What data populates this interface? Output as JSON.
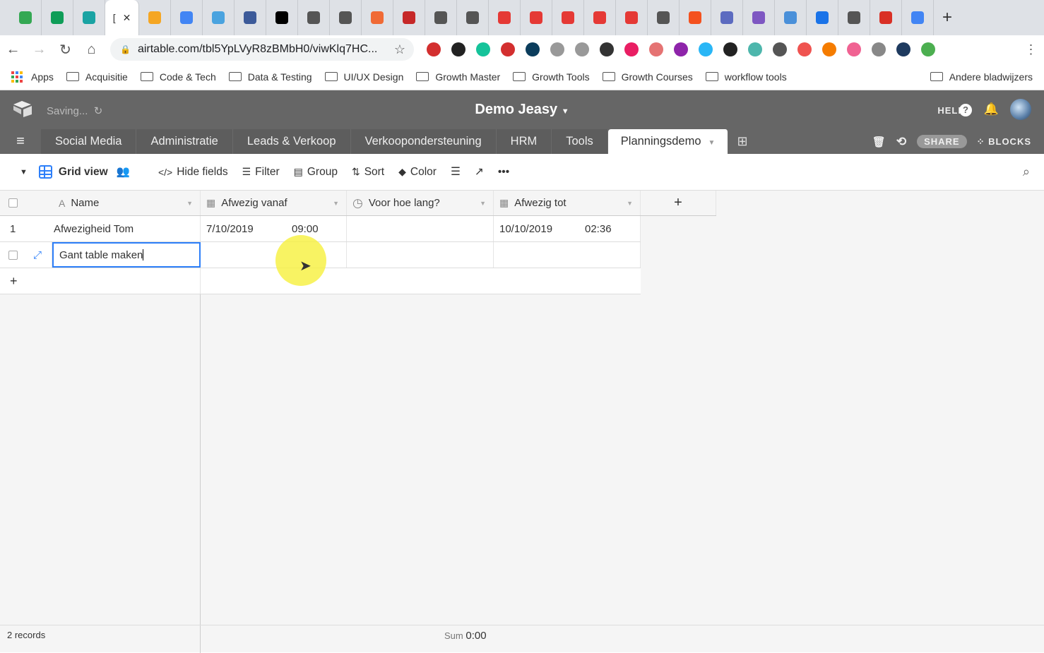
{
  "browser": {
    "active_tab_label": "[",
    "tab_colors": [
      "#34a853",
      "#0f9d58",
      "#1aa3a3",
      "#f5a623",
      "#4285f4",
      "#4aa3df",
      "#3c5a99",
      "#000000",
      "#555555",
      "#555555",
      "#f06a35",
      "#c62828",
      "#555555",
      "#555555",
      "#e53935",
      "#e53935",
      "#e53935",
      "#e53935",
      "#e53935",
      "#555555",
      "#f4511e",
      "#5c6bc0",
      "#7e57c2",
      "#4a90d9",
      "#1a73e8",
      "#555555",
      "#d93025",
      "#4285f4"
    ],
    "url": "airtable.com/tbl5YpLVyR8zBMbH0/viwKlq7HC...",
    "extension_colors": [
      "#d32f2f",
      "#222222",
      "#15c39a",
      "#d32f2f",
      "#0b3d5c",
      "#999999",
      "#999999",
      "#333333",
      "#e91e63",
      "#e57373",
      "#8e24aa",
      "#29b6f6",
      "#222222",
      "#4db6ac",
      "#555555",
      "#ef5350",
      "#f57c00",
      "#f06292",
      "#888888",
      "#1e3a5f",
      "#4caf50"
    ],
    "bookmarks": {
      "apps": "Apps",
      "folders": [
        "Acquisitie",
        "Code & Tech",
        "Data & Testing",
        "UI/UX Design",
        "Growth Master",
        "Growth Tools",
        "Growth Courses",
        "workflow tools"
      ],
      "other": "Andere bladwijzers"
    }
  },
  "header": {
    "status": "Saving...",
    "base_name": "Demo Jeasy",
    "help": "HELP",
    "help_icon": "?"
  },
  "tables": [
    "Social Media",
    "Administratie",
    "Leads & Verkoop",
    "Verkoopondersteuning",
    "HRM",
    "Tools",
    "Planningsdemo"
  ],
  "active_table": "Planningsdemo",
  "table_actions": {
    "share": "SHARE",
    "blocks": "BLOCKS"
  },
  "toolbar": {
    "view": "Grid view",
    "hide_fields": "Hide fields",
    "filter": "Filter",
    "group": "Group",
    "sort": "Sort",
    "color": "Color"
  },
  "columns": [
    {
      "name": "Name",
      "icon": "text-icon"
    },
    {
      "name": "Afwezig vanaf",
      "icon": "calendar-icon"
    },
    {
      "name": "Voor hoe lang?",
      "icon": "clock-icon"
    },
    {
      "name": "Afwezig tot",
      "icon": "calendar-icon"
    }
  ],
  "rows": [
    {
      "num": "1",
      "name": "Afwezigheid Tom",
      "from_date": "7/10/2019",
      "from_time": "09:00",
      "duration": "",
      "to_date": "10/10/2019",
      "to_time": "02:36"
    },
    {
      "num": "",
      "name": "Gant table maken",
      "from_date": "",
      "from_time": "",
      "duration": "",
      "to_date": "",
      "to_time": ""
    }
  ],
  "footer": {
    "records": "2 records",
    "sum_label": "Sum",
    "sum_value": "0:00"
  },
  "accent": "#2d7ff9"
}
